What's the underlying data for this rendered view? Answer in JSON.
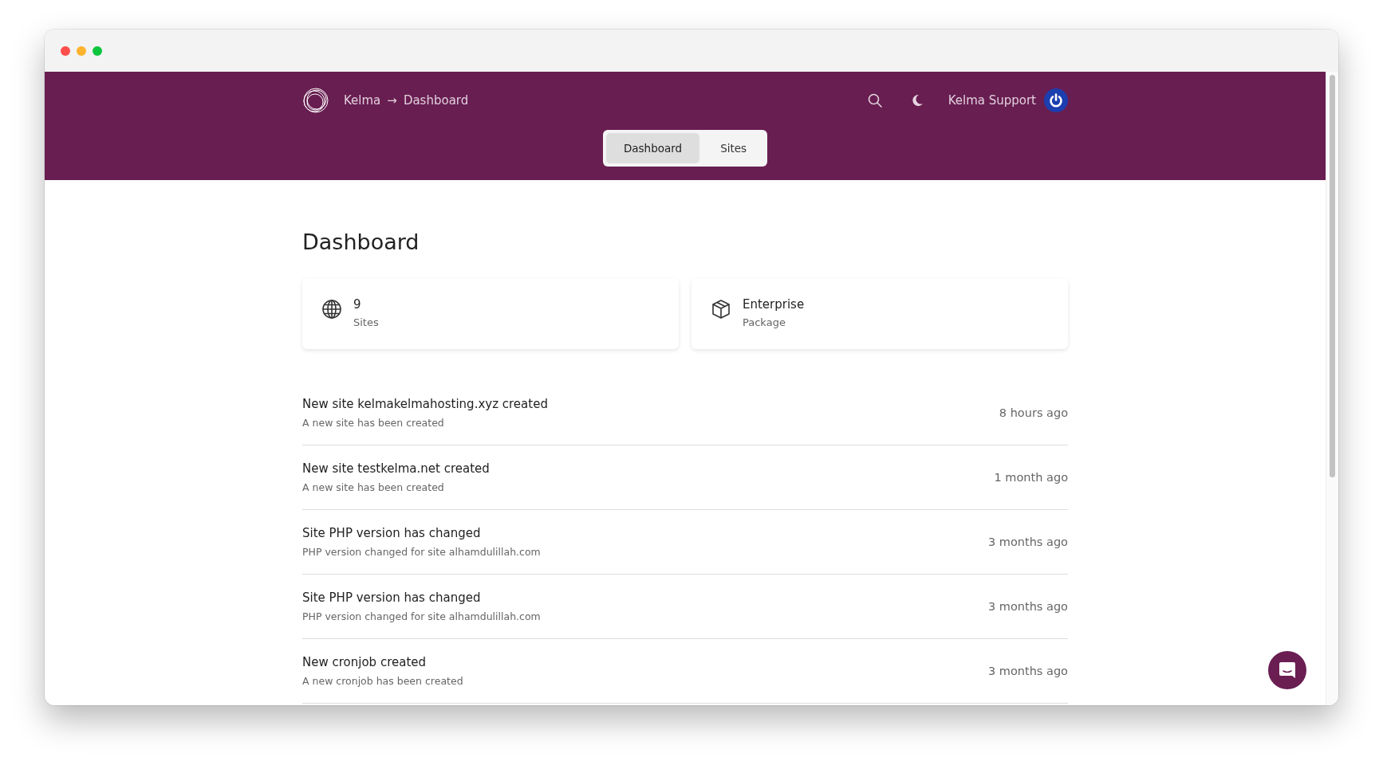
{
  "header": {
    "breadcrumb": [
      "Kelma",
      "Dashboard"
    ],
    "breadcrumb_separator": "→",
    "user_name": "Kelma Support"
  },
  "tabs": [
    {
      "label": "Dashboard",
      "selected": true
    },
    {
      "label": "Sites",
      "selected": false
    }
  ],
  "page_title": "Dashboard",
  "stats": [
    {
      "kind": "globe",
      "value": "9",
      "label": "Sites"
    },
    {
      "kind": "package",
      "value": "Enterprise",
      "label": "Package"
    }
  ],
  "activity": [
    {
      "title": "New site kelmakelmahosting.xyz created",
      "description": "A new site has been created",
      "time": "8 hours ago"
    },
    {
      "title": "New site testkelma.net created",
      "description": "A new site has been created",
      "time": "1 month ago"
    },
    {
      "title": "Site PHP version has changed",
      "description": "PHP version changed for site alhamdulillah.com",
      "time": "3 months ago"
    },
    {
      "title": "Site PHP version has changed",
      "description": "PHP version changed for site alhamdulillah.com",
      "time": "3 months ago"
    },
    {
      "title": "New cronjob created",
      "description": "A new cronjob has been created",
      "time": "3 months ago"
    }
  ]
}
